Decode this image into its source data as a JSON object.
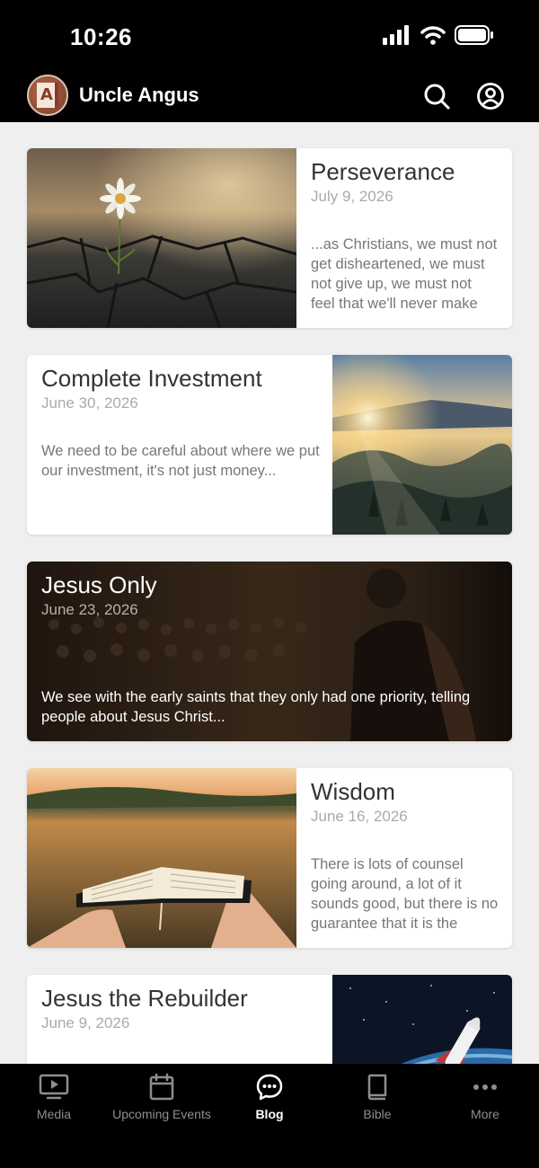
{
  "status_bar": {
    "time": "10:26"
  },
  "header": {
    "title": "Uncle Angus"
  },
  "posts": [
    {
      "title": "Perseverance",
      "date": "July 9, 2026",
      "excerpt": "...as Christians, we must not get disheartened, we must not give up, we must not feel that we'll never make it..."
    },
    {
      "title": "Complete Investment",
      "date": "June 30, 2026",
      "excerpt": "We need to be careful about where we put our investment, it's not just money..."
    },
    {
      "title": "Jesus Only",
      "date": "June 23, 2026",
      "excerpt": "We see with the early saints that they only had one priority, telling people about Jesus Christ..."
    },
    {
      "title": "Wisdom",
      "date": "June 16, 2026",
      "excerpt": "There is lots of counsel going around, a lot of it sounds good, but there is no guarantee that it is the truth..."
    },
    {
      "title": "Jesus the Rebuilder",
      "date": "June 9, 2026",
      "excerpt": ""
    }
  ],
  "tabs": [
    {
      "label": "Media",
      "icon": "monitor-play-icon",
      "active": false
    },
    {
      "label": "Upcoming Events",
      "icon": "calendar-icon",
      "active": false
    },
    {
      "label": "Blog",
      "icon": "chat-bubble-icon",
      "active": true
    },
    {
      "label": "Bible",
      "icon": "book-icon",
      "active": false
    },
    {
      "label": "More",
      "icon": "more-dots-icon",
      "active": false
    }
  ],
  "colors": {
    "bar_background": "#000000",
    "page_background": "#efefef",
    "active_tab": "#ffffff",
    "inactive_tab": "#8e8e8e"
  }
}
